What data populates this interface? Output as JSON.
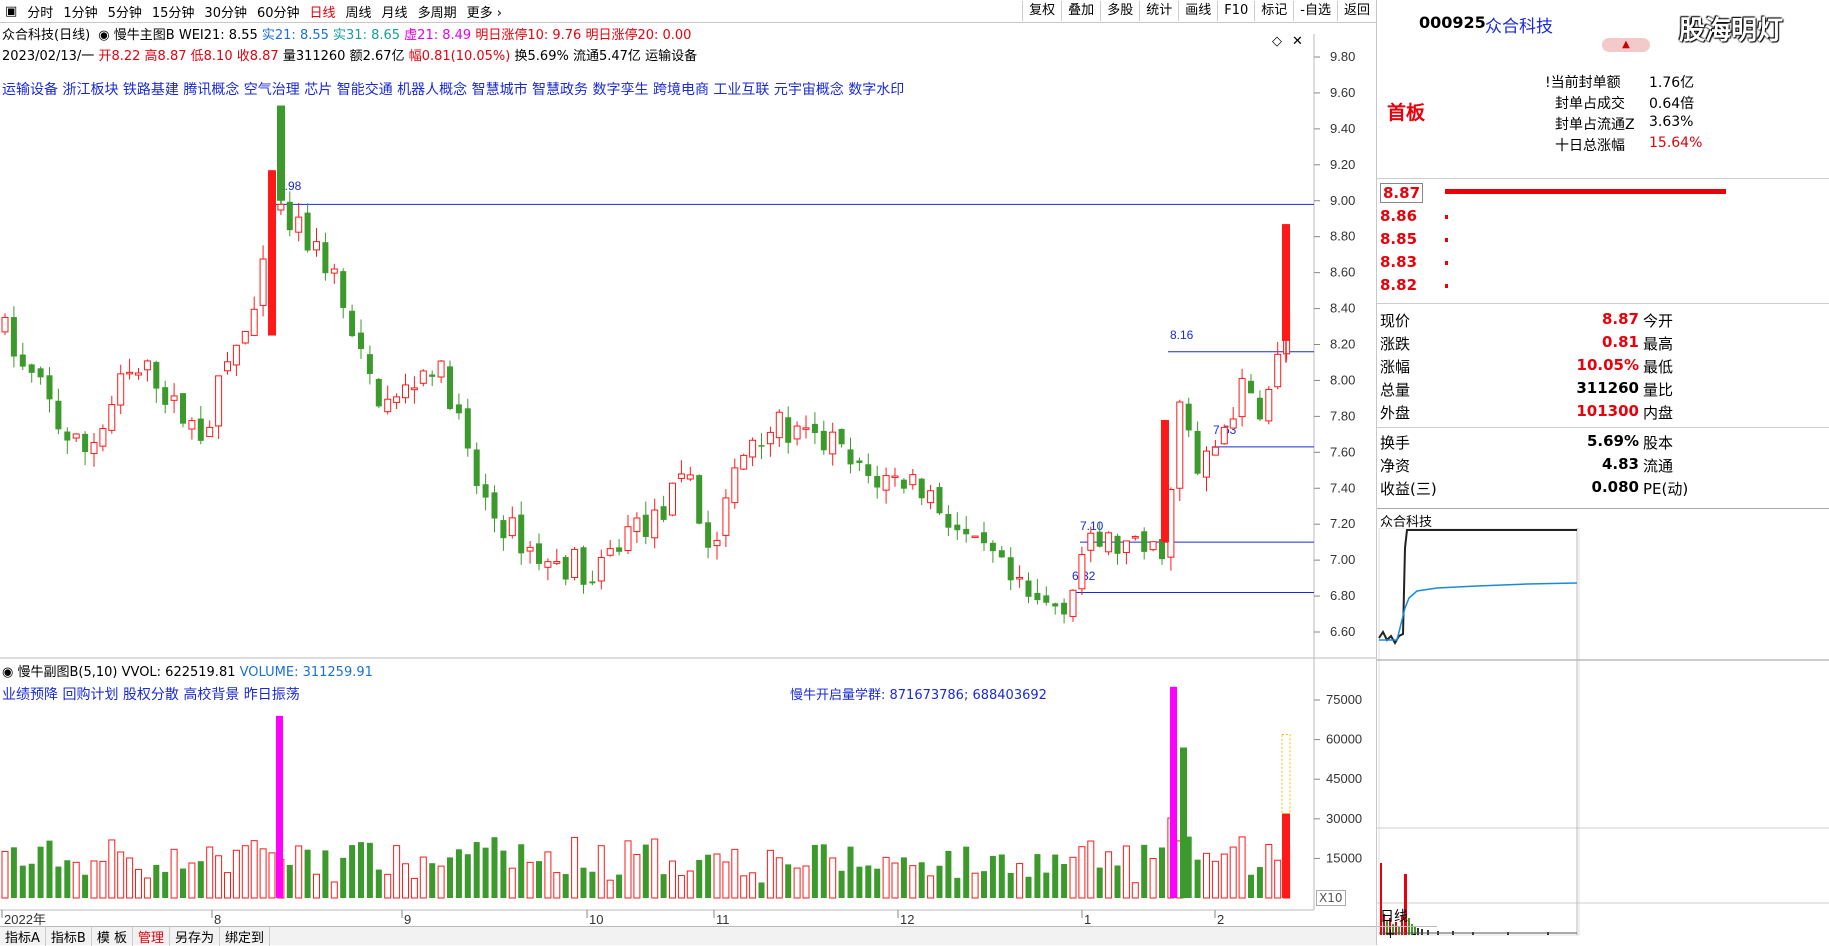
{
  "toolbar": {
    "periods": [
      "分时",
      "1分钟",
      "5分钟",
      "15分钟",
      "30分钟",
      "60分钟",
      "日线",
      "周线",
      "月线",
      "多周期",
      "更多"
    ],
    "active_period": "日线",
    "tools": [
      "复权",
      "叠加",
      "多股",
      "统计",
      "画线",
      "F10",
      "标记",
      "-自选",
      "返回"
    ]
  },
  "header": {
    "title": "众合科技(日线)",
    "indicator_name": "慢牛主图B",
    "wei21": "WEI21: 8.55",
    "shi21": "实21: 8.55",
    "shi31": "实31: 8.65",
    "xu21": "虚21: 8.49",
    "zt10": "明日涨停10: 9.76",
    "zt20": "明日涨停20: 0.00",
    "date": "2023/02/13/一",
    "open": "开8.22",
    "high": "高8.87",
    "low": "低8.10",
    "close": "收8.87",
    "vol": "量311260",
    "amount": "额2.67亿",
    "range": "幅0.81(10.05%)",
    "turnover": "换5.69%",
    "float": "流通5.47亿",
    "industry": "运输设备",
    "concepts": "运输设备 浙江板块 铁路基建 腾讯概念 空气治理 芯片 智能交通 机器人概念 智慧城市 智慧政务 数字孪生 跨境电商 工业互联 元宇宙概念 数字水印"
  },
  "price_axis": [
    "9.80",
    "9.60",
    "9.40",
    "9.20",
    "9.00",
    "8.80",
    "8.60",
    "8.40",
    "8.20",
    "8.00",
    "7.80",
    "7.60",
    "7.40",
    "7.20",
    "7.00",
    "6.80",
    "6.60"
  ],
  "price_labels": [
    "8.98",
    "8.16",
    "7.63",
    "7.10",
    "6.82"
  ],
  "volume_header": {
    "name": "慢牛副图B(5,10)",
    "vvol": "VVOL: 622519.81",
    "volume": "VOLUME: 311259.91",
    "tags": "业绩预降 回购计划 股权分散 高校背景 昨日振荡",
    "group": "慢牛开启量学群: 871673786; 688403692"
  },
  "volume_axis": [
    "75000",
    "60000",
    "45000",
    "30000",
    "15000"
  ],
  "volume_unit": "X10",
  "time_axis": [
    "2022年",
    "8",
    "9",
    "10",
    "11",
    "12",
    "1",
    "2"
  ],
  "status_bar": [
    "指标A",
    "指标B",
    "模 板",
    "管理",
    "另存为",
    "绑定到"
  ],
  "status_bar_active": "管理",
  "right_panel": {
    "code": "000925",
    "name": "众合科技",
    "watermark": "股海明灯",
    "first_board": "首板",
    "seal_amount_label": "当前封单额",
    "seal_amount": "1.76亿",
    "seal_vs_deal_label": "封单占成交",
    "seal_vs_deal": "0.64倍",
    "seal_vs_float_label": "封单占流通Z",
    "seal_vs_float": "3.63%",
    "ten_day_label": "十日总涨幅",
    "ten_day": "15.64%",
    "ladder": [
      "8.87",
      "8.86",
      "8.85",
      "8.83",
      "8.82"
    ],
    "quote_left_labels": [
      "现价",
      "涨跌",
      "涨幅",
      "总量",
      "外盘"
    ],
    "quote_left_values": [
      "8.87",
      "0.81",
      "10.05%",
      "311260",
      "101300"
    ],
    "quote_right_labels": [
      "今开",
      "最高",
      "最低",
      "量比",
      "内盘"
    ],
    "fund_labels": [
      "换手",
      "净资",
      "收益(三)"
    ],
    "fund_values": [
      "5.69%",
      "4.83",
      "0.080"
    ],
    "fund_right_labels": [
      "股本",
      "流通",
      "PE(动)"
    ],
    "mini_title": "众合科技",
    "bottom_tab": "日线"
  },
  "colors": {
    "up": "#ff1a1a",
    "down": "#3c9a2c",
    "magenta": "#ff00ff",
    "line": "#1a2ad8"
  },
  "chart_data": {
    "type": "candlestick",
    "title": "众合科技(日线)",
    "ylim": [
      6.5,
      9.9
    ],
    "horizontal_levels": [
      8.98,
      8.16,
      7.63,
      7.1,
      6.82
    ],
    "last_bar": {
      "date": "2023/02/13",
      "open": 8.22,
      "high": 8.87,
      "low": 8.1,
      "close": 8.87,
      "volume": 311260
    },
    "volume_ylim": [
      0,
      80000
    ]
  }
}
